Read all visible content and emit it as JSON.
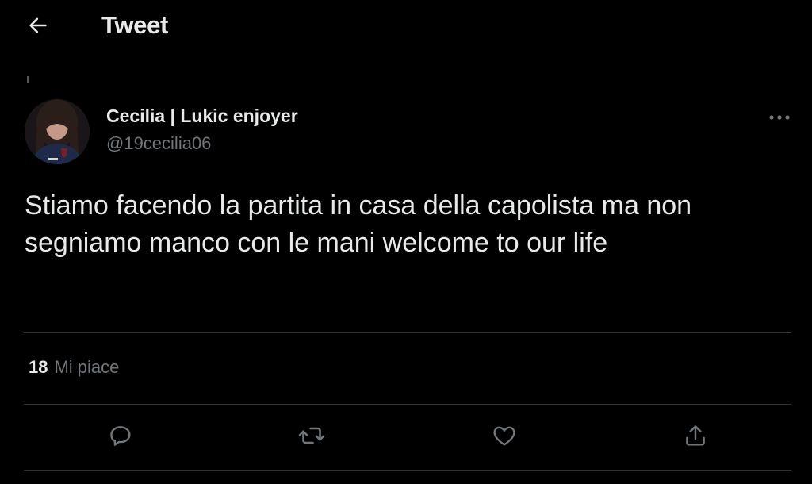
{
  "header": {
    "title": "Tweet",
    "back_icon": "arrow-left-icon"
  },
  "tweet": {
    "author_name": "Cecilia | Lukic enjoyer",
    "author_handle": "@19cecilia06",
    "text": "Stiamo facendo la partita in casa della capolista ma non segniamo manco con le mani welcome to our life",
    "likes_count": "18",
    "likes_label": "Mi piace"
  },
  "actions": [
    {
      "icon": "reply-icon"
    },
    {
      "icon": "retweet-icon"
    },
    {
      "icon": "like-icon"
    },
    {
      "icon": "share-icon"
    }
  ],
  "colors": {
    "background": "#000000",
    "text_primary": "#e7e9ea",
    "text_secondary": "#71767b",
    "divider": "#2f3336"
  }
}
